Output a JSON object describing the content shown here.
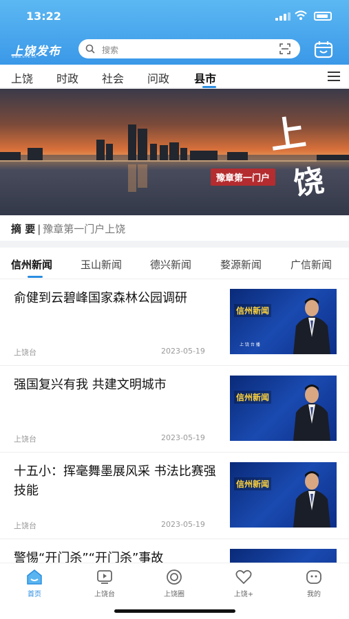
{
  "status": {
    "time": "13:22"
  },
  "header": {
    "logo_text": "上饶发布",
    "logo_sub": "www.srfb.cn",
    "search_placeholder": "搜索"
  },
  "channels": [
    "上饶",
    "时政",
    "社会",
    "问政",
    "县市"
  ],
  "active_channel": "县市",
  "banner": {
    "tag": "豫章第一门户",
    "big_char_1": "上",
    "big_char_2": "饶"
  },
  "summary": {
    "label": "摘 要",
    "sep": "|",
    "text": "豫章第一门户上饶"
  },
  "subtabs": [
    "信州新闻",
    "玉山新闻",
    "德兴新闻",
    "婺源新闻",
    "广信新闻"
  ],
  "news": [
    {
      "title": "俞健到云碧峰国家森林公园调研",
      "source": "上饶台",
      "date": "2023-05-19",
      "thumb_label": "信州新闻",
      "thumb_sub": "上 饶 台 播"
    },
    {
      "title": "强国复兴有我 共建文明城市",
      "source": "上饶台",
      "date": "2023-05-19",
      "thumb_label": "信州新闻"
    },
    {
      "title": "十五小：挥毫舞墨展风采 书法比赛强技能",
      "source": "上饶台",
      "date": "2023-05-19",
      "thumb_label": "信州新闻"
    },
    {
      "title": "警惕“开门杀”“开门杀”事故",
      "thumb_label": ""
    }
  ],
  "bottom_nav": [
    "首页",
    "上饶台",
    "上饶圈",
    "上饶+",
    "我的"
  ],
  "colors": {
    "accent": "#2a8de0",
    "header_top": "#5cb8f2",
    "header_bottom": "#3a98e8"
  }
}
